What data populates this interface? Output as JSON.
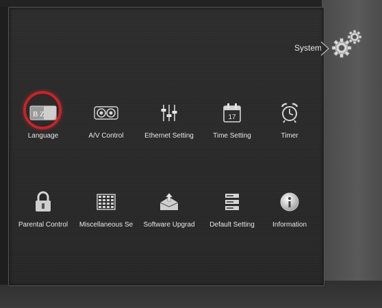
{
  "header": {
    "title": "System"
  },
  "selected_index": 0,
  "menu": {
    "row1": [
      {
        "label": "Language",
        "icon": "language-icon"
      },
      {
        "label": "A/V Control",
        "icon": "av-control-icon"
      },
      {
        "label": "Ethernet Setting",
        "icon": "ethernet-sliders-icon"
      },
      {
        "label": "Time Setting",
        "icon": "calendar-icon",
        "calendar_day": "17"
      },
      {
        "label": "Timer",
        "icon": "alarm-clock-icon"
      }
    ],
    "row2": [
      {
        "label": "Parental Control",
        "icon": "padlock-icon"
      },
      {
        "label": "Miscellaneous Se",
        "icon": "keypad-grid-icon"
      },
      {
        "label": "Software Upgrad",
        "icon": "upgrade-box-icon"
      },
      {
        "label": "Default Setting",
        "icon": "server-stack-icon"
      },
      {
        "label": "Information",
        "icon": "info-disc-icon"
      }
    ]
  },
  "language_icon_text": "B Z",
  "colors": {
    "selection_ring": "#c0262c",
    "panel": "#2a2a2a",
    "text": "#e8e8e8"
  }
}
